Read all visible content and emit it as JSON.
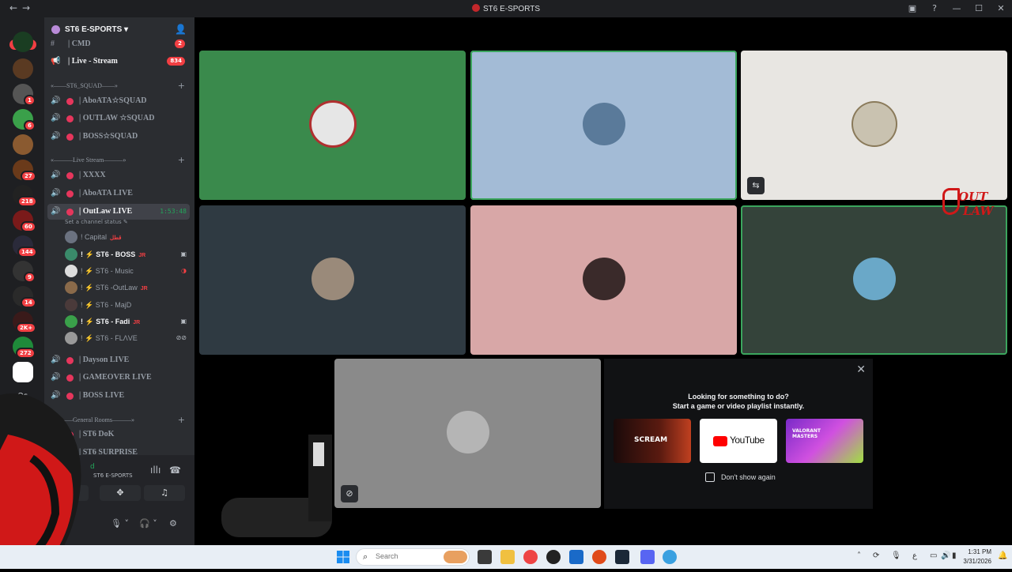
{
  "window": {
    "title": "ST6 E-SPORTS"
  },
  "server_rail": {
    "new_label": "NEW",
    "badges": [
      "1",
      "6",
      "27",
      "218",
      "60",
      "144",
      "9",
      "14",
      "2K+",
      "272"
    ],
    "os_label": "Os"
  },
  "server": {
    "name": "ST6 E-SPORTS"
  },
  "channels": {
    "top": [
      {
        "name": "| CMD",
        "count": "2"
      },
      {
        "name": "| Live - Stream",
        "count": "834"
      }
    ],
    "cat1": "«——ST6_SQUAD——»",
    "squad": [
      "| AboATA☆SQUAD",
      "| OUTLAW ☆SQUAD",
      "| BOSS☆SQUAD"
    ],
    "cat2": "«———Live Stream———»",
    "live": [
      "| XXXX",
      "| AboATA LIVE"
    ],
    "active": {
      "name": "| OutLaw LIVE",
      "timer": "1:53:48",
      "status": "Set a channel status"
    },
    "users": [
      {
        "name": "! Capital",
        "tag": "قطل"
      },
      {
        "name": "! ⚡ ST6 - BOSS",
        "tag": "JR"
      },
      {
        "name": "! ⚡ ST6 - Music",
        "tag": ""
      },
      {
        "name": "! ⚡ ST6 -OutLaw",
        "tag": "JR"
      },
      {
        "name": "! ⚡ ST6 - MajD",
        "tag": ""
      },
      {
        "name": "! ⚡ ST6 - Fadi",
        "tag": "JR"
      },
      {
        "name": "! ⚡ ST6 - FLΛVE",
        "tag": ""
      }
    ],
    "more_live": [
      "| Dayson LIVE",
      "| GAMEOVER LIVE",
      "| BOSS LIVE"
    ],
    "cat3": "«———General Rooms———»",
    "general": [
      "| ST6 DoK",
      "| ST6 SURPRISE"
    ]
  },
  "voice_panel": {
    "user_partial": "d",
    "server": "ST6 E-SPORTS"
  },
  "activity": {
    "line1": "Looking for something to do?",
    "line2": "Start a game or video playlist instantly.",
    "cards": [
      "SCREAM",
      "YouTube",
      "VALORANT MASTERS"
    ],
    "dont_show": "Don't show again"
  },
  "overlay_logo": {
    "text1": "OUT",
    "text2": "LAW"
  },
  "taskbar": {
    "search_placeholder": "Search",
    "time": "1:31 PM",
    "date": "3/31/2026",
    "lang": "ع"
  },
  "colors": {
    "accent_green": "#3ba55d",
    "live_red": "#e6365c",
    "tile_green": "#3a8a4c",
    "tile_blue": "#a3bbd6",
    "tile_pink": "#d8a7a7"
  }
}
